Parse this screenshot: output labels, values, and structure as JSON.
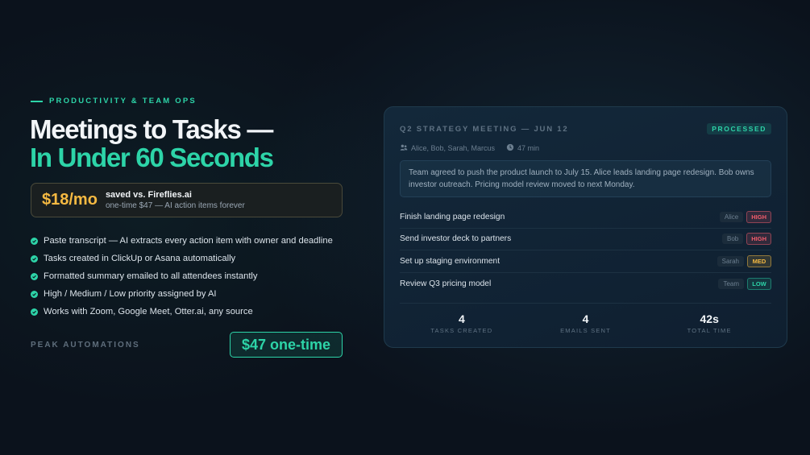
{
  "eyebrow": "PRODUCTIVITY & TEAM OPS",
  "headline": {
    "line1": "Meetings to Tasks —",
    "line2": "In Under 60 Seconds"
  },
  "savings": {
    "price": "$18/mo",
    "line1": "saved vs. Fireflies.ai",
    "line2": "one-time $47 — AI action items forever"
  },
  "features": [
    "Paste transcript — AI extracts every action item with owner and deadline",
    "Tasks created in ClickUp or Asana automatically",
    "Formatted summary emailed to all attendees instantly",
    "High / Medium / Low priority assigned by AI",
    "Works with Zoom, Google Meet, Otter.ai, any source"
  ],
  "brand": "PEAK AUTOMATIONS",
  "cta": "$47 one-time",
  "card": {
    "title": "Q2 STRATEGY MEETING — JUN 12",
    "status": "PROCESSED",
    "attendees": "Alice, Bob, Sarah, Marcus",
    "duration": "47 min",
    "summary": "Team agreed to push the product launch to July 15. Alice leads landing page redesign. Bob owns investor outreach. Pricing model review moved to next Monday.",
    "tasks": [
      {
        "name": "Finish landing page redesign",
        "owner": "Alice",
        "priority": "HIGH"
      },
      {
        "name": "Send investor deck to partners",
        "owner": "Bob",
        "priority": "HIGH"
      },
      {
        "name": "Set up staging environment",
        "owner": "Sarah",
        "priority": "MED"
      },
      {
        "name": "Review Q3 pricing model",
        "owner": "Team",
        "priority": "LOW"
      }
    ],
    "stats": [
      {
        "value": "4",
        "label": "TASKS CREATED"
      },
      {
        "value": "4",
        "label": "EMAILS SENT"
      },
      {
        "value": "42s",
        "label": "TOTAL TIME"
      }
    ]
  },
  "colors": {
    "accent": "#2dd4a8",
    "price": "#f5b942",
    "high": "#f05c6b",
    "background": "#0b121c"
  },
  "icons": [
    "check-circle-icon",
    "users-icon",
    "clock-icon"
  ]
}
